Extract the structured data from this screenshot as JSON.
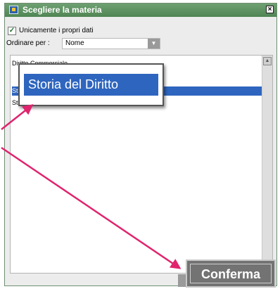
{
  "window": {
    "title": "Scegliere la materia",
    "close_label": "×"
  },
  "filters": {
    "own_data_label": "Unicamente i propri dati",
    "own_data_checked": true,
    "order_label": "Ordinare per :",
    "order_value": "Nome"
  },
  "list": {
    "items": [
      {
        "label": "Diritto Commerciale"
      },
      {
        "label": "Storia del Diritto"
      },
      {
        "label": "Storia della protezione civile"
      }
    ],
    "selected_index": 1
  },
  "popup": {
    "label": "Storia del Diritto"
  },
  "confirm_label": "Conferma",
  "annotation": {
    "arrow_color": "#e0246e"
  },
  "colors": {
    "titlebar": "#5c9160",
    "selection": "#2e65bf"
  },
  "icons": [
    "app-icon",
    "close-icon",
    "checkmark-icon",
    "dropdown-arrow-icon",
    "scroll-up-icon"
  ]
}
